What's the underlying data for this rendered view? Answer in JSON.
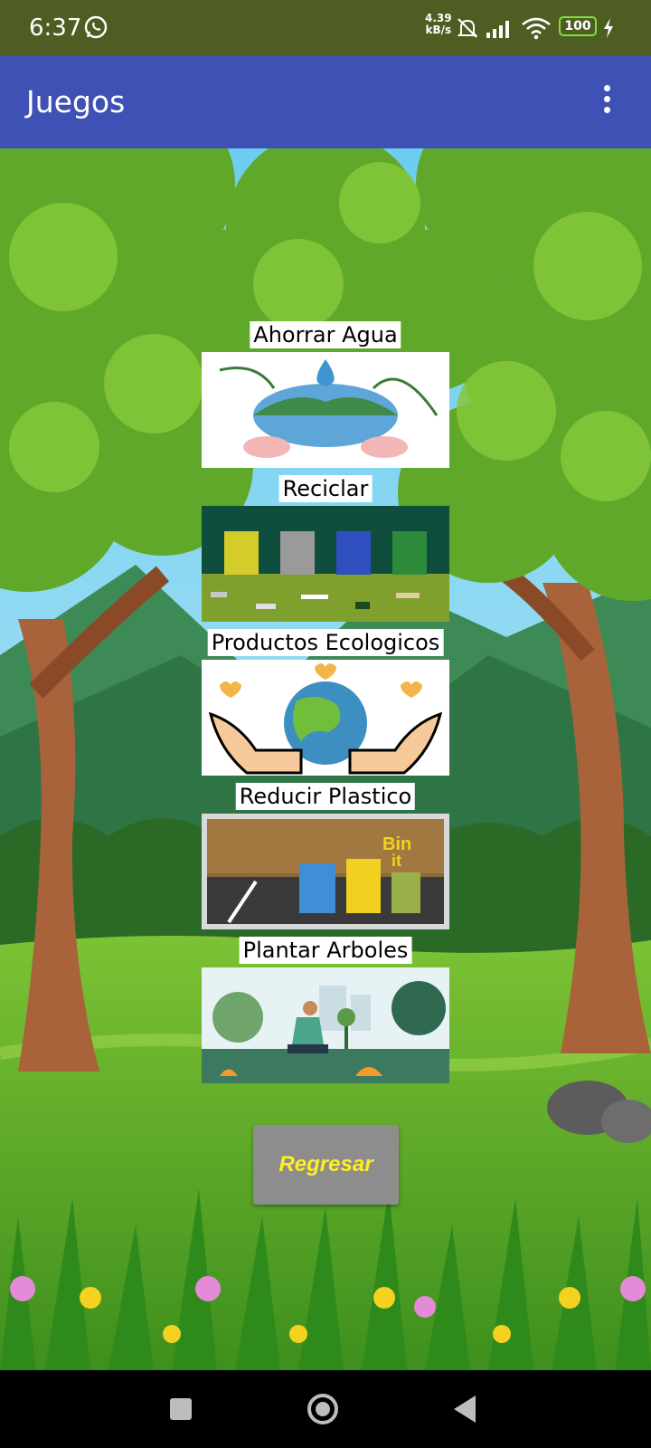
{
  "status_bar": {
    "time": "6:37",
    "net_speed_value": "4.39",
    "net_speed_unit": "kB/s",
    "battery": "100",
    "icons": [
      "whatsapp-icon",
      "mute-icon",
      "signal-icon",
      "wifi-icon",
      "battery-icon",
      "charging-icon"
    ]
  },
  "app_bar": {
    "title": "Juegos",
    "menu_icon": "more-vert-icon"
  },
  "games": [
    {
      "label": "Ahorrar Agua",
      "image": "earth-water-drop-hands"
    },
    {
      "label": "Reciclar",
      "image": "recycling-bins-trash"
    },
    {
      "label": "Productos Ecologicos",
      "image": "hands-holding-earth-hearts"
    },
    {
      "label": "Reducir Plastico",
      "image": "bin-it-recycling-bins"
    },
    {
      "label": "Plantar Arboles",
      "image": "person-planting-tree"
    }
  ],
  "back_button": {
    "label": "Regresar"
  },
  "nav_bar": {
    "icons": [
      "recents-square-icon",
      "home-circle-icon",
      "back-triangle-icon"
    ]
  },
  "colors": {
    "status_bar": "#4e5e22",
    "app_bar": "#3f51b5",
    "button_bg": "#8d8d8d",
    "button_text": "#ffee22"
  }
}
